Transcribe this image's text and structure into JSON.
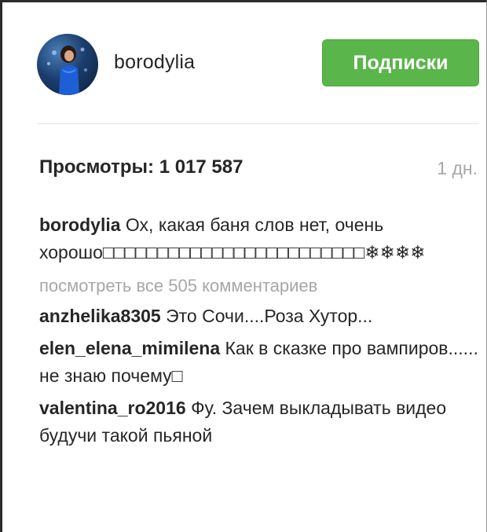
{
  "post_header": {
    "username": "borodylia",
    "follow_button": "Подписки"
  },
  "stats": {
    "views_label": "Просмотры:",
    "views_count": "1 017 587",
    "time_ago": "1 дн."
  },
  "caption": {
    "username": "borodylia",
    "text": "Ох, какая баня слов нет, очень хорошо□□□□□□□□□□□□□□□□□□□□□□□□❄❄❄❄"
  },
  "view_all_comments": "посмотреть все 505 комментариев",
  "comments": [
    {
      "username": "anzhelika8305",
      "text": "Это Сочи....Роза Хутор..."
    },
    {
      "username": "elen_elena_mimilena",
      "text": "Как в сказке про вампиров...... не знаю почему□"
    },
    {
      "username": "valentina_ro2016",
      "text": "Фу. Зачем выкладывать видео будучи такой пьяной"
    }
  ],
  "colors": {
    "follow_button": "#5ab54a",
    "muted_text": "#a5a7aa",
    "primary_text": "#262626"
  }
}
